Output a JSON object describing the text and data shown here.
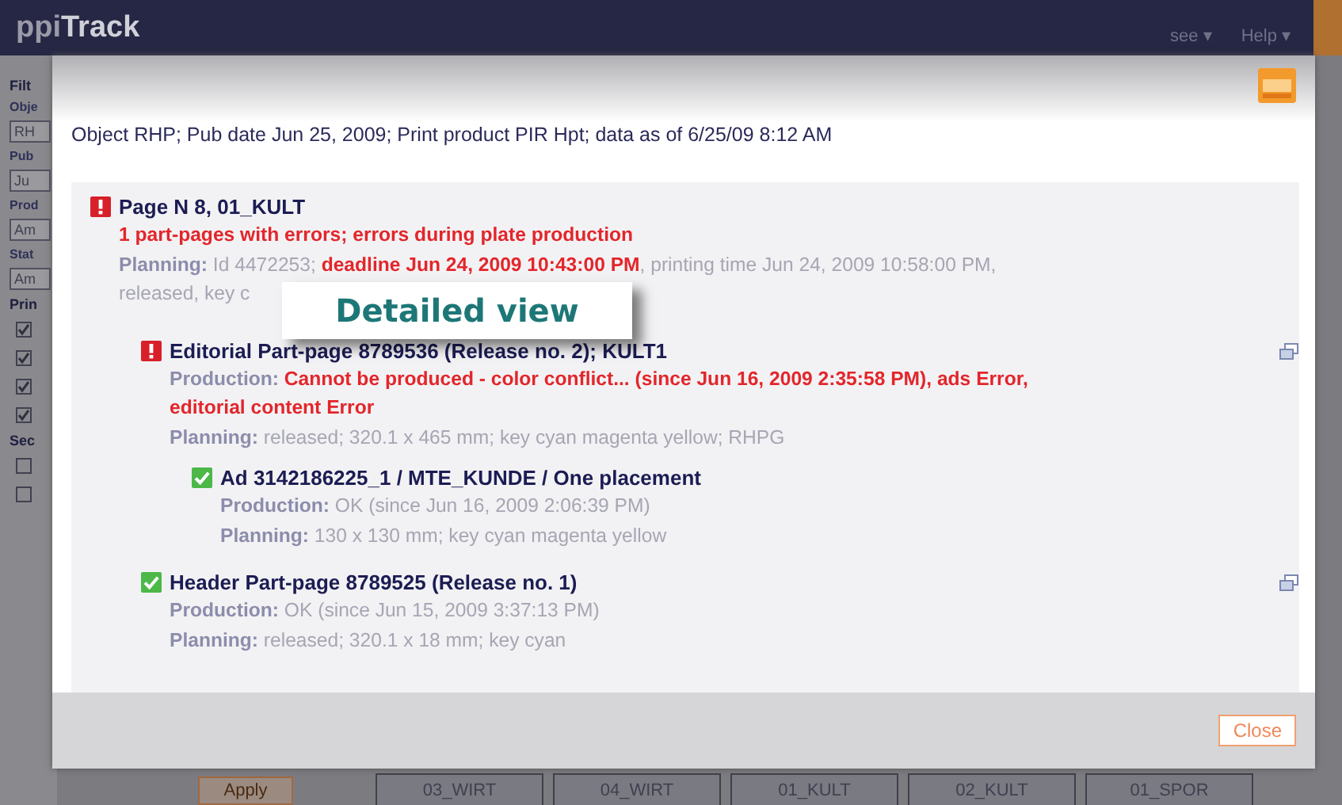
{
  "header": {
    "logo_prefix": "ppi",
    "logo_main": "Track",
    "menus": [
      "see ▾",
      "Help ▾"
    ]
  },
  "sidebar": {
    "heading": "Filt",
    "fields": [
      {
        "label": "Obje",
        "value": "RH"
      },
      {
        "label": "Pub",
        "value": "Ju"
      },
      {
        "label": "Prod",
        "value": "Am"
      },
      {
        "label": "Stat",
        "value": "Am"
      }
    ],
    "print_heading": "Prin",
    "print_checks": [
      {
        "checked": true
      },
      {
        "checked": true
      },
      {
        "checked": true
      },
      {
        "checked": true
      }
    ],
    "section_heading": "Sec",
    "section_checks": [
      {
        "checked": false
      },
      {
        "checked": false
      }
    ]
  },
  "bottom": {
    "apply": "Apply",
    "tabs": [
      "03_WIRT",
      "04_WIRT",
      "01_KULT",
      "02_KULT",
      "01_SPOR"
    ]
  },
  "dialog": {
    "info": "Object RHP; Pub date Jun 25, 2009; Print product PIR Hpt; data as of 6/25/09 8:12 AM",
    "items": [
      {
        "kind": "error",
        "title": "Page N 8, 01_KULT",
        "expandable": false,
        "lines": [
          [
            {
              "kind": "error",
              "text": "1 part-pages with errors; errors during plate production"
            }
          ],
          [
            {
              "kind": "label",
              "text": "Planning:"
            },
            {
              "kind": "normal",
              "text": "Id 4472253;"
            },
            {
              "kind": "error",
              "text": "deadline Jun 24, 2009 10:43:00 PM"
            },
            {
              "kind": "normal",
              "text": ", printing time Jun 24, 2009 10:58:00 PM,"
            }
          ],
          [
            {
              "kind": "normal",
              "text": "released, key c"
            }
          ]
        ],
        "children": [
          {
            "kind": "error",
            "title": "Editorial Part-page 8789536 (Release no. 2); KULT1",
            "expandable": true,
            "lines": [
              [
                {
                  "kind": "label",
                  "text": "Production:"
                },
                {
                  "kind": "error",
                  "text": "Cannot be produced - color conflict... (since Jun 16, 2009 2:35:58 PM), ads Error,"
                }
              ],
              [
                {
                  "kind": "error",
                  "text": "editorial content Error"
                }
              ],
              [
                {
                  "kind": "label",
                  "text": "Planning:"
                },
                {
                  "kind": "normal",
                  "text": "released; 320.1 x 465 mm; key cyan magenta yellow; RHPG"
                }
              ]
            ],
            "children": [
              {
                "kind": "ok",
                "title": "Ad 3142186225_1 / MTE_KUNDE / One placement",
                "expandable": false,
                "lines": [
                  [
                    {
                      "kind": "label",
                      "text": "Production:"
                    },
                    {
                      "kind": "normal",
                      "text": "OK (since Jun 16, 2009 2:06:39 PM)"
                    }
                  ],
                  [
                    {
                      "kind": "label",
                      "text": "Planning:"
                    },
                    {
                      "kind": "normal",
                      "text": "130 x 130 mm; key cyan magenta yellow"
                    }
                  ]
                ]
              }
            ]
          },
          {
            "kind": "ok",
            "title": "Header Part-page 8789525 (Release no. 1)",
            "expandable": true,
            "lines": [
              [
                {
                  "kind": "label",
                  "text": "Production:"
                },
                {
                  "kind": "normal",
                  "text": "OK (since Jun 15, 2009 3:37:13 PM)"
                }
              ],
              [
                {
                  "kind": "label",
                  "text": "Planning:"
                },
                {
                  "kind": "normal",
                  "text": "released; 320.1 x 18 mm; key cyan"
                }
              ]
            ]
          }
        ]
      }
    ],
    "close": "Close"
  },
  "callout": "Detailed view"
}
